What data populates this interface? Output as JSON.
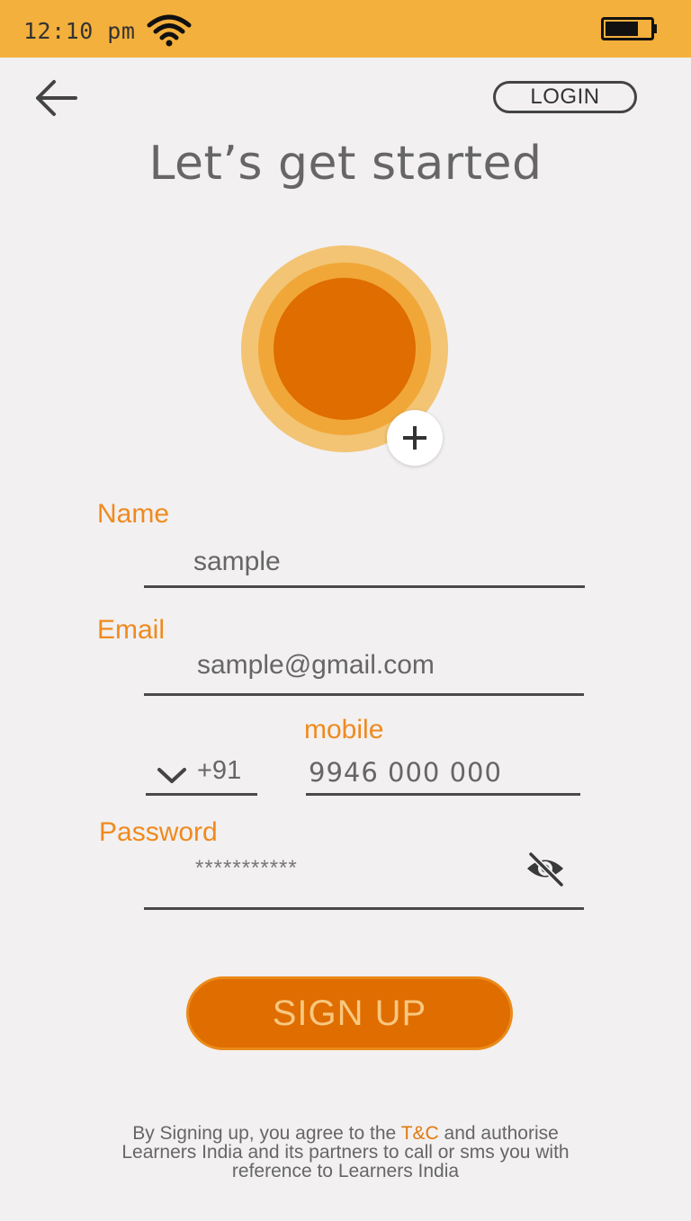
{
  "status_bar": {
    "time": "12:10 pm",
    "wifi_icon": "wifi-icon",
    "battery_icon": "battery-icon",
    "background_color": "#f4b03c"
  },
  "header": {
    "back_icon": "arrow-left-icon",
    "login_label": "LOGIN",
    "title": "Let’s get started"
  },
  "avatar": {
    "add_icon": "plus-icon",
    "colors": [
      "#f2c474",
      "#f1a737",
      "#df6d00"
    ]
  },
  "form": {
    "name": {
      "label": "Name",
      "value": "sample"
    },
    "email": {
      "label": "Email",
      "value": "sample@gmail.com"
    },
    "mobile": {
      "label": "mobile",
      "country_code": "+91",
      "value": "9946 000 000",
      "dropdown_icon": "chevron-down-icon"
    },
    "password": {
      "label": "Password",
      "value": "***********",
      "toggle_icon": "eye-off-icon"
    }
  },
  "signup": {
    "label": "SIGN UP",
    "color": "#df6d00"
  },
  "footer": {
    "line1_prefix": "By Signing up, you agree to the ",
    "tc_link": "T&C",
    "line1_suffix": " and authorise",
    "line2": "Learners India and its partners to call or sms you with",
    "line3": "reference to Learners India",
    "accent_color": "#e07a10"
  }
}
